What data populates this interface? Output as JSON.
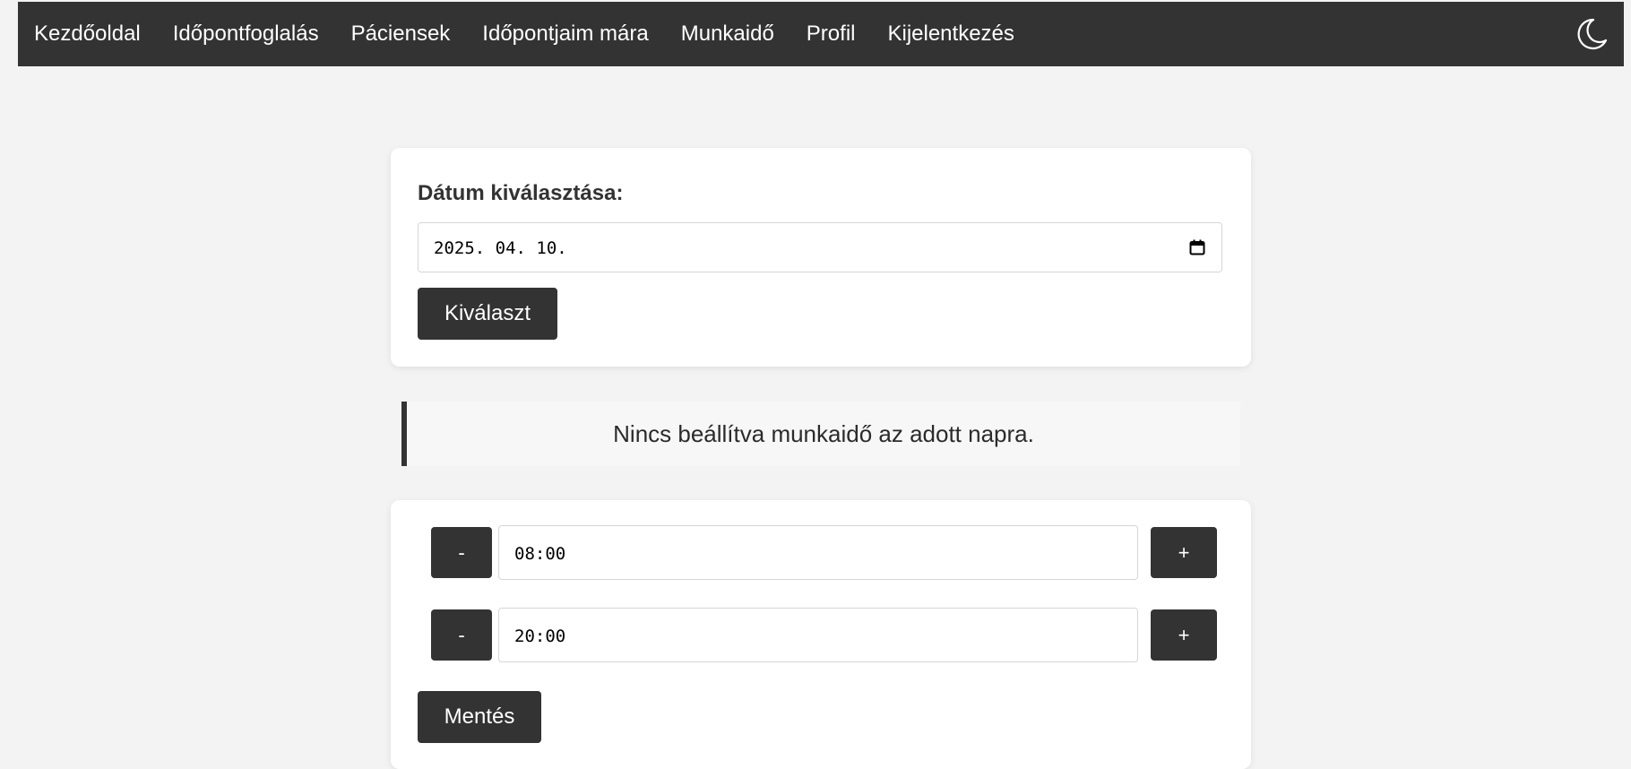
{
  "nav": {
    "items": [
      {
        "label": "Kezdőoldal"
      },
      {
        "label": "Időpontfoglalás"
      },
      {
        "label": "Páciensek"
      },
      {
        "label": "Időpontjaim mára"
      },
      {
        "label": "Munkaidő"
      },
      {
        "label": "Profil"
      },
      {
        "label": "Kijelentkezés"
      }
    ],
    "theme_toggle_icon": "moon-icon"
  },
  "date_card": {
    "label": "Dátum kiválasztása:",
    "date_value": "2025. 04. 10.",
    "calendar_icon": "calendar-icon",
    "select_button": "Kiválaszt"
  },
  "notice": {
    "text": "Nincs beállítva munkaidő az adott napra."
  },
  "time_card": {
    "start": {
      "minus": "-",
      "value": "08:00",
      "plus": "+"
    },
    "end": {
      "minus": "-",
      "value": "20:00",
      "plus": "+"
    },
    "save_button": "Mentés"
  },
  "colors": {
    "navbar": "#333333",
    "background": "#f3f3f3",
    "card": "#ffffff",
    "button": "#333333",
    "notice_bg": "#f7f7f7"
  }
}
